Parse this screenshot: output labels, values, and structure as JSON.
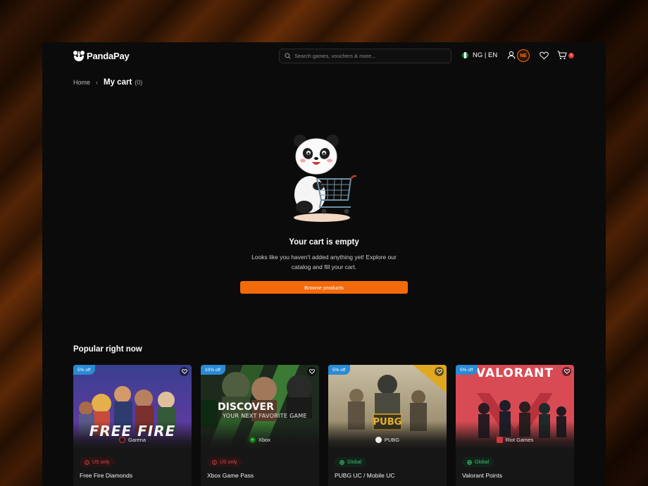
{
  "brand": {
    "name": "PandaPay"
  },
  "search": {
    "placeholder": "Search games, vouchers & more..."
  },
  "header": {
    "language": "NG | EN",
    "avatar_initials": "NE",
    "cart_count": "0"
  },
  "breadcrumb": {
    "home": "Home",
    "current": "My cart",
    "count": "(0)"
  },
  "empty_state": {
    "title": "Your cart is empty",
    "description": "Looks like you haven't added anything yet! Explore our catalog and fill your cart.",
    "button_label": "Browse products"
  },
  "popular": {
    "title": "Popular right now",
    "cards": [
      {
        "discount": "5% off",
        "publisher": "Garena",
        "region": "US only",
        "name": "Free Fire Diamonds",
        "banner_text": "FREE FIRE"
      },
      {
        "discount": "10% off",
        "publisher": "Xbox",
        "region": "US only",
        "name": "Xbox Game Pass",
        "banner_text": "DISCOVER",
        "banner_sub": "YOUR NEXT FAVORITE GAME"
      },
      {
        "discount": "5% off",
        "publisher": "PUBG",
        "region": "Global",
        "name": "PUBG UC / Mobile UC",
        "banner_text": "PUBG"
      },
      {
        "discount": "5% off",
        "publisher": "Riot Games",
        "region": "Global",
        "name": "Valorant Points",
        "banner_text": "VALORANT"
      }
    ]
  },
  "colors": {
    "accent": "#f26a0a",
    "discount": "#2a8bd4",
    "us_only": "#e24b4b",
    "global": "#3fbf74"
  }
}
